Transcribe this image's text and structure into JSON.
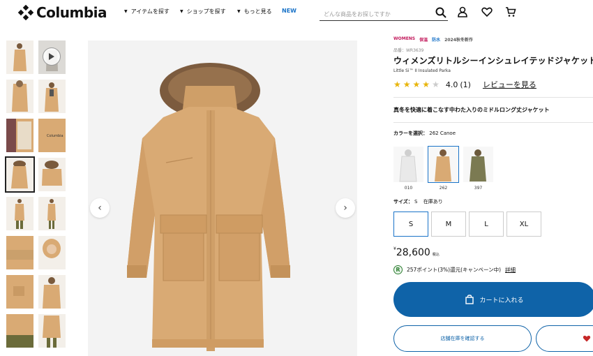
{
  "brand": {
    "name": "Columbia"
  },
  "nav": [
    {
      "label": "アイテムを探す"
    },
    {
      "label": "ショップを探す"
    },
    {
      "label": "もっと見る"
    }
  ],
  "nav_new": "NEW",
  "search": {
    "placeholder": "どんな商品をお探しですか"
  },
  "icons": [
    "columbia-logo-icon",
    "search-icon",
    "user-icon",
    "heart-icon",
    "cart-icon",
    "play-icon",
    "chevron-left-icon",
    "chevron-right-icon"
  ],
  "product": {
    "tags": [
      "WOMENS",
      "保温",
      "防水",
      "2024秋冬新作"
    ],
    "number": "品番：WR3639",
    "name": "ウィメンズリトルシーインシュレイテッドジャケット",
    "name_en": "Little Si™ II Insulated Parka",
    "rating": "4.0",
    "rating_value": 4.0,
    "review_count": "(1)",
    "review_link": "レビューを見る",
    "tagline": "真冬を快適に着こなす中わた入りのミドルロング丈ジャケット",
    "color_label": "カラーを選択：",
    "color_selected": "262 Canoe",
    "colors": [
      {
        "code": "010",
        "hex": "#e9e9e9"
      },
      {
        "code": "262",
        "hex": "#d9aa74"
      },
      {
        "code": "397",
        "hex": "#7b7a52"
      }
    ],
    "size_label": "サイズ：",
    "size_selected": "S",
    "stock": "在庫あり",
    "sizes": [
      "S",
      "M",
      "L",
      "XL"
    ],
    "price_yen": "¥",
    "price": "28,600",
    "price_tax": "税込",
    "points_icon": "R",
    "points_text": "257ポイント(3%)還元(キャンペーン中)",
    "points_detail": "詳細",
    "cart_button": "カートに入れる",
    "store_button": "店舗在庫を確認する"
  },
  "colors": {
    "accent": "#0f63a8",
    "star": "#e8b50c",
    "womens": "#c2185b",
    "coat": "#d9aa74"
  }
}
